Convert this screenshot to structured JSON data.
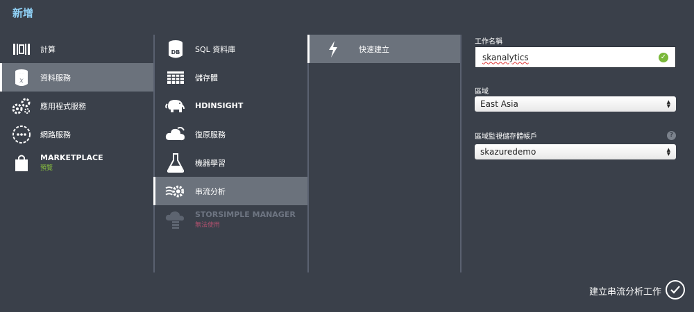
{
  "header": {
    "title": "新增"
  },
  "categories": [
    {
      "label": "計算",
      "icon": "compute-icon"
    },
    {
      "label": "資料服務",
      "icon": "data-services-icon",
      "selected": true
    },
    {
      "label": "應用程式服務",
      "icon": "app-services-icon"
    },
    {
      "label": "網路服務",
      "icon": "network-services-icon"
    },
    {
      "label": "MARKETPLACE",
      "sub": "預覽",
      "icon": "marketplace-bag-icon"
    }
  ],
  "services": [
    {
      "label": "SQL 資料庫",
      "icon": "database-icon"
    },
    {
      "label": "儲存體",
      "icon": "storage-grid-icon"
    },
    {
      "label": "HDINSIGHT",
      "icon": "elephant-icon"
    },
    {
      "label": "復原服務",
      "icon": "recovery-cloud-icon"
    },
    {
      "label": "機器學習",
      "icon": "flask-icon"
    },
    {
      "label": "串流分析",
      "icon": "stream-gear-icon",
      "selected": true
    },
    {
      "label": "STORSIMPLE MANAGER",
      "sub": "無法使用",
      "icon": "cloud-storage-icon",
      "disabled": true
    }
  ],
  "options": [
    {
      "label": "快速建立",
      "icon": "lightning-icon",
      "selected": true
    }
  ],
  "form": {
    "job_name_label": "工作名稱",
    "job_name_value": "skanalytics",
    "region_label": "區域",
    "region_value": "East Asia",
    "storage_label": "區域監視儲存體帳戶",
    "storage_value": "skazuredemo",
    "help_glyph": "?"
  },
  "footer": {
    "submit_label": "建立串流分析工作"
  }
}
